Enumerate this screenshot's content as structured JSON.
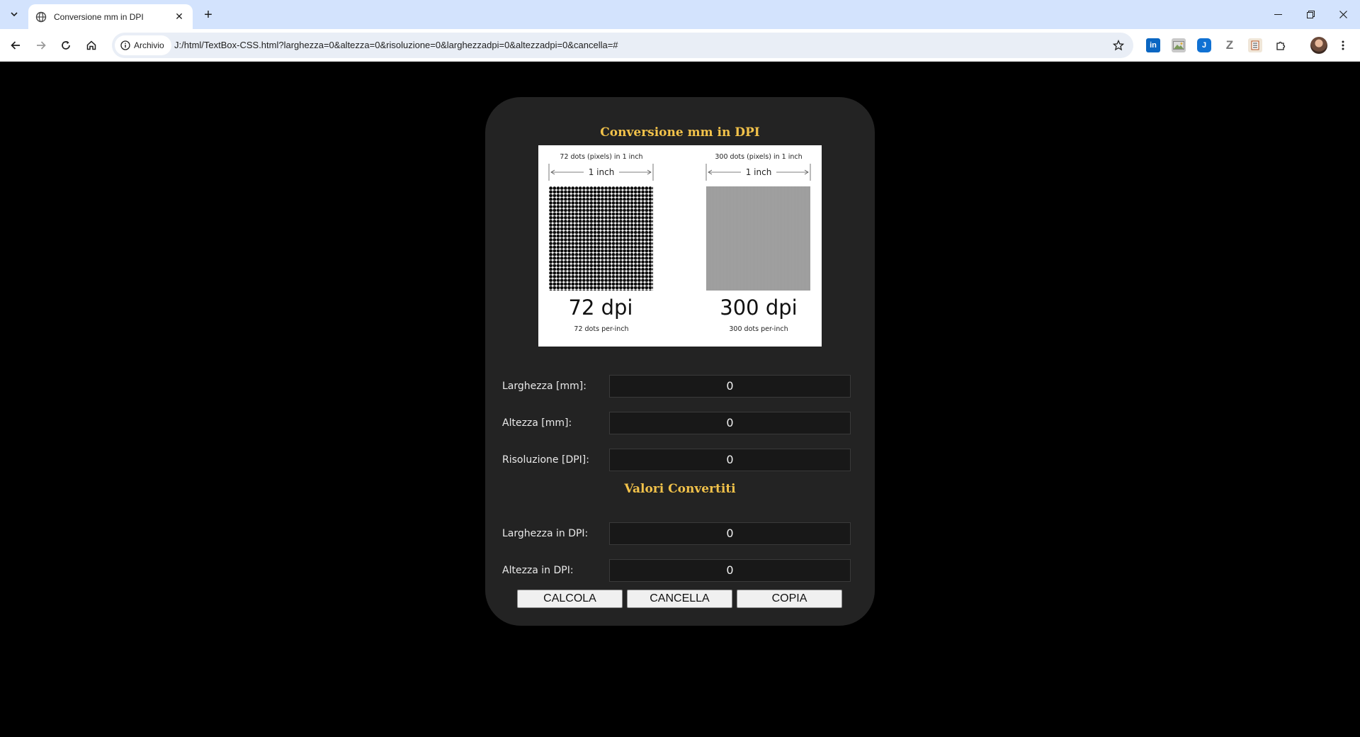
{
  "browser": {
    "tab_title": "Conversione mm in DPI",
    "site_chip": "Archivio",
    "url": "J:/html/TextBox-CSS.html?larghezza=0&altezza=0&risoluzione=0&larghezzadpi=0&altezzadpi=0&cancella=#",
    "extensions": [
      "linkedin-icon",
      "image-icon",
      "joplin-icon",
      "zotero-icon",
      "reader-icon",
      "puzzle-icon"
    ]
  },
  "page": {
    "title": "Conversione mm in DPI",
    "figure": {
      "left": {
        "caption": "72 dots (pixels) in 1 inch",
        "ruler": "1 inch",
        "big": "72 dpi",
        "small": "72 dots per-inch"
      },
      "right": {
        "caption": "300 dots (pixels) in 1 inch",
        "ruler": "1 inch",
        "big": "300 dpi",
        "small": "300 dots per-inch"
      }
    },
    "fields": {
      "larghezza": {
        "label": "Larghezza [mm]:",
        "value": "0"
      },
      "altezza": {
        "label": "Altezza [mm]:",
        "value": "0"
      },
      "risoluzione": {
        "label": "Risoluzione [DPI]:",
        "value": "0"
      }
    },
    "converted_title": "Valori Convertiti",
    "results": {
      "larghezza_dpi": {
        "label": "Larghezza in DPI:",
        "value": "0"
      },
      "altezza_dpi": {
        "label": "Altezza in DPI:",
        "value": "0"
      }
    },
    "buttons": {
      "calcola": "CALCOLA",
      "cancella": "CANCELLA",
      "copia": "COPIA"
    }
  }
}
